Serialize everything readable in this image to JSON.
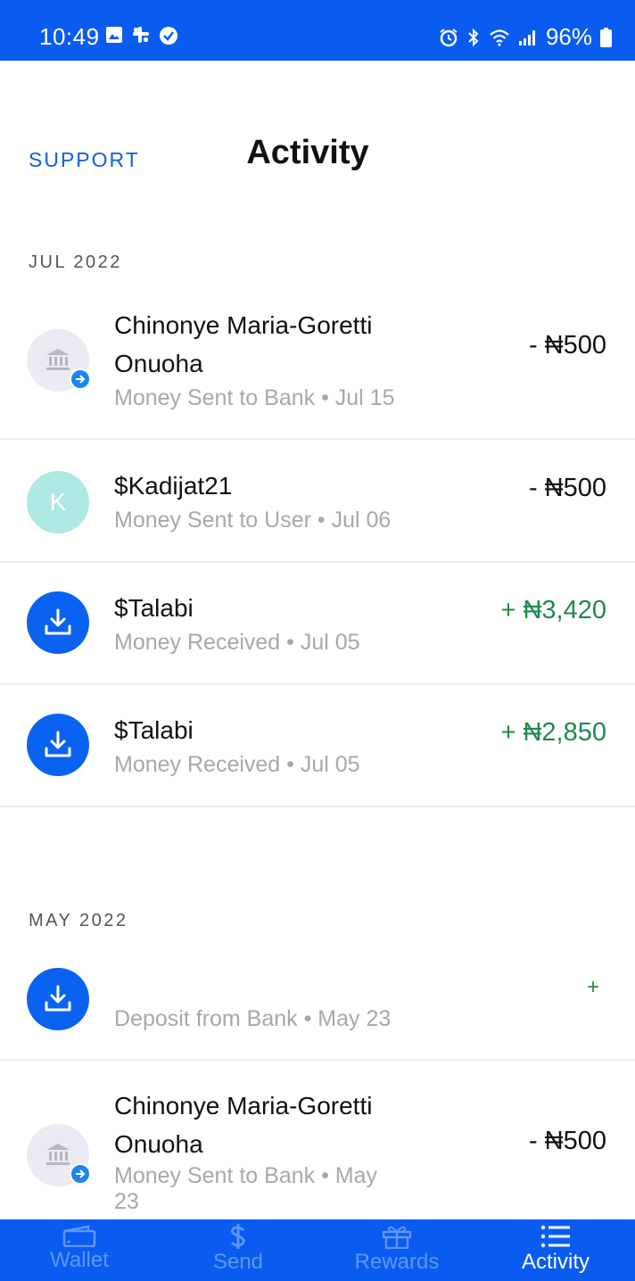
{
  "status_bar": {
    "time": "10:49",
    "battery": "96%"
  },
  "header": {
    "support_label": "SUPPORT",
    "title": "Activity"
  },
  "sections": [
    {
      "label": "JUL 2022",
      "transactions": [
        {
          "name_line1": "Chinonye Maria-Goretti",
          "name_line2": "Onuoha",
          "subtitle": "Money Sent to Bank • Jul 15",
          "amount": "- ₦500",
          "icon": "bank-icon"
        },
        {
          "name": "$Kadijat21",
          "avatar_letter": "K",
          "subtitle": "Money Sent to User • Jul 06",
          "amount": "- ₦500"
        },
        {
          "name": "$Talabi",
          "subtitle": "Money Received • Jul 05",
          "amount": "+ ₦3,420",
          "icon": "download-icon"
        },
        {
          "name": "$Talabi",
          "subtitle": "Money Received • Jul 05",
          "amount": "+ ₦2,850",
          "icon": "download-icon"
        }
      ]
    },
    {
      "label": "MAY 2022",
      "transactions": [
        {
          "name": "",
          "subtitle": "Deposit from Bank • May 23",
          "amount": "+",
          "icon": "download-icon"
        },
        {
          "name_line1": "Chinonye Maria-Goretti",
          "name_line2": "Onuoha",
          "subtitle_line1": "Money Sent to Bank • May",
          "subtitle_line2": "23",
          "amount": "- ₦500",
          "icon": "bank-icon"
        }
      ]
    }
  ],
  "tabs": [
    {
      "label": "Wallet",
      "icon": "wallet-icon"
    },
    {
      "label": "Send",
      "icon": "dollar-icon"
    },
    {
      "label": "Rewards",
      "icon": "gift-icon"
    },
    {
      "label": "Activity",
      "icon": "list-icon",
      "active": true
    }
  ],
  "colors": {
    "brand_blue": "#0a5cf0",
    "positive_green": "#1e8a4a",
    "link_blue": "#0a63e0"
  }
}
